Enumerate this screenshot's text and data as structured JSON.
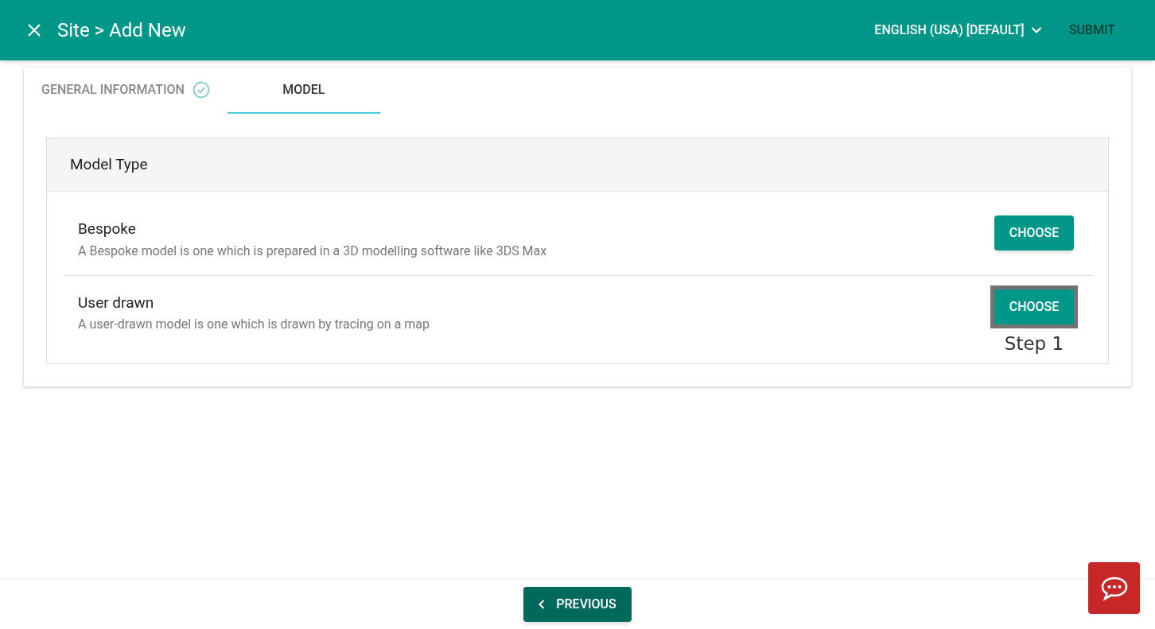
{
  "header": {
    "title": "Site > Add New",
    "language": "ENGLISH (USA) [DEFAULT]",
    "submit": {
      "label": "SUBMIT",
      "disabled": true
    }
  },
  "tabs": [
    {
      "label": "GENERAL INFORMATION",
      "selected": false,
      "completed": true
    },
    {
      "label": "MODEL",
      "selected": true,
      "completed": false
    }
  ],
  "panel": {
    "title": "Model Type",
    "options": [
      {
        "name": "Bespoke",
        "description": "A Bespoke model is one which is prepared in a 3D modelling software like 3DS Max",
        "button": "CHOOSE",
        "highlighted": false
      },
      {
        "name": "User drawn",
        "description": "A user-drawn model is one which is drawn by tracing on a map",
        "button": "CHOOSE",
        "highlighted": true,
        "annotation": "Step 1"
      }
    ]
  },
  "footer": {
    "previous": "PREVIOUS"
  }
}
